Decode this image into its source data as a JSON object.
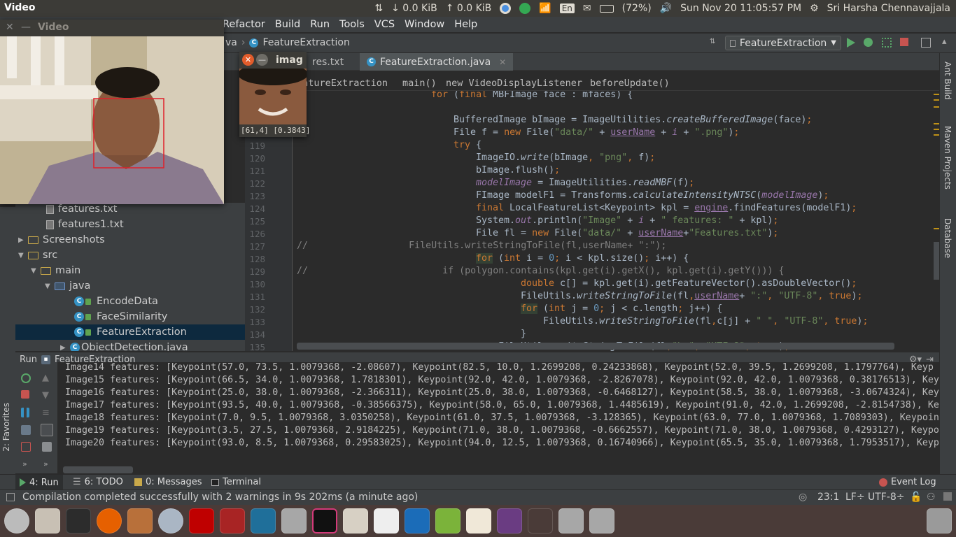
{
  "top_panel": {
    "app_title": "Video",
    "net_down": "↓ 0.0 KiB",
    "net_up": "↑ 0.0 KiB",
    "keyboard": "En",
    "battery": "(72%)",
    "datetime": "Sun Nov 20 11:05:57 PM",
    "user": "Sri Harsha Chennavajjala"
  },
  "menu": [
    "Refactor",
    "Build",
    "Run",
    "Tools",
    "VCS",
    "Window",
    "Help"
  ],
  "toolbar": {
    "crumb_partial": "va",
    "crumb_class": "FeatureExtraction",
    "run_config": "FeatureExtraction"
  },
  "tabs": [
    {
      "label": "res.txt"
    },
    {
      "label": "FeatureExtraction.java"
    }
  ],
  "editor_breadcrumb": [
    "eatureExtraction",
    "main()",
    "new VideoDisplayListener",
    "beforeUpdate()"
  ],
  "gutter_lines": [
    "119",
    "120",
    "121",
    "122",
    "123",
    "124",
    "125",
    "126",
    "127",
    "128",
    "129",
    "130",
    "131",
    "132",
    "133",
    "134",
    "135"
  ],
  "right_tools": [
    "Ant Build",
    "Maven Projects",
    "Database"
  ],
  "project_tree": [
    {
      "label": "features.txt",
      "kind": "file",
      "depth": 2
    },
    {
      "label": "features1.txt",
      "kind": "file",
      "depth": 2
    },
    {
      "label": "Screenshots",
      "kind": "folder",
      "depth": 0,
      "expanded": false
    },
    {
      "label": "src",
      "kind": "folder",
      "depth": 0,
      "expanded": true
    },
    {
      "label": "main",
      "kind": "folder",
      "depth": 1,
      "expanded": true
    },
    {
      "label": "java",
      "kind": "folder",
      "depth": 2,
      "expanded": true
    },
    {
      "label": "EncodeData",
      "kind": "class",
      "depth": 3
    },
    {
      "label": "FaceSimilarity",
      "kind": "class",
      "depth": 3
    },
    {
      "label": "FeatureExtraction",
      "kind": "class",
      "depth": 3,
      "selected": true
    },
    {
      "label": "ObjectDetection.java",
      "kind": "class",
      "depth": 2,
      "expanded": false
    }
  ],
  "run_panel": {
    "title": "Run",
    "config": "FeatureExtraction",
    "lines": [
      "Image14 features: [Keypoint(57.0, 73.5, 1.0079368, -2.08607), Keypoint(82.5, 10.0, 1.2699208, 0.24233868), Keypoint(52.0, 39.5, 1.2699208, 1.1797764), Keyp",
      "Image15 features: [Keypoint(66.5, 34.0, 1.0079368, 1.7818301), Keypoint(92.0, 42.0, 1.0079368, -2.8267078), Keypoint(92.0, 42.0, 1.0079368, 0.38176513), Keyp",
      "Image16 features: [Keypoint(25.0, 38.0, 1.0079368, -2.366311), Keypoint(25.0, 38.0, 1.0079368, -0.6468127), Keypoint(58.5, 38.0, 1.0079368, -3.0674324), Keyp",
      "Image17 features: [Keypoint(93.5, 40.0, 1.0079368, -0.38566375), Keypoint(58.0, 65.0, 1.0079368, 1.4485619), Keypoint(91.0, 42.0, 1.2699208, -2.8154738), Key",
      "Image18 features: [Keypoint(7.0, 9.5, 1.0079368, 3.0350258), Keypoint(61.0, 37.5, 1.0079368, -3.128365), Keypoint(63.0, 77.0, 1.0079368, 1.7089303), Keypoint",
      "Image19 features: [Keypoint(3.5, 27.5, 1.0079368, 2.9184225), Keypoint(71.0, 38.0, 1.0079368, -0.6662557), Keypoint(71.0, 38.0, 1.0079368, 0.4293127), Keypo",
      "Image20 features: [Keypoint(93.0, 8.5, 1.0079368, 0.29583025), Keypoint(94.0, 12.5, 1.0079368, 0.16740966), Keypoint(65.5, 35.0, 1.0079368, 1.7953517), Keyp"
    ]
  },
  "bottom_tabs": {
    "run": "4: Run",
    "todo": "6: TODO",
    "messages": "0: Messages",
    "terminal": "Terminal",
    "event_log": "Event Log",
    "favorites": "2: Favorites"
  },
  "status": {
    "message": "Compilation completed successfully with 2 warnings in 9s 202ms (a minute ago)",
    "position": "23:1",
    "line_sep": "LF÷",
    "encoding": "UTF-8÷"
  },
  "video_window": {
    "title": "Video"
  },
  "image_window": {
    "title": "imag",
    "readout": "[61,4] [0.3843]"
  },
  "colors": {
    "keyword": "#cc7832",
    "string": "#6a8759",
    "field": "#9876aa",
    "selection": "#0d293e",
    "face_box": "#e0202a"
  }
}
